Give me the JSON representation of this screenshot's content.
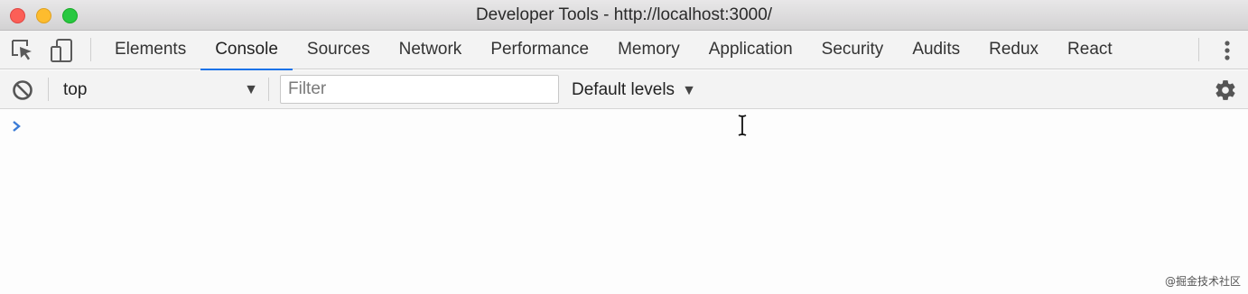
{
  "window": {
    "title": "Developer Tools - http://localhost:3000/"
  },
  "tabs": [
    {
      "label": "Elements",
      "active": false
    },
    {
      "label": "Console",
      "active": true
    },
    {
      "label": "Sources",
      "active": false
    },
    {
      "label": "Network",
      "active": false
    },
    {
      "label": "Performance",
      "active": false
    },
    {
      "label": "Memory",
      "active": false
    },
    {
      "label": "Application",
      "active": false
    },
    {
      "label": "Security",
      "active": false
    },
    {
      "label": "Audits",
      "active": false
    },
    {
      "label": "Redux",
      "active": false
    },
    {
      "label": "React",
      "active": false
    }
  ],
  "toolbar": {
    "context": "top",
    "filter_placeholder": "Filter",
    "filter_value": "",
    "levels": "Default levels"
  },
  "icons": {
    "inspect": "inspect-element-icon",
    "device": "device-toolbar-icon",
    "more": "more-vertical-icon",
    "clear": "clear-console-icon",
    "settings": "gear-icon",
    "prompt": "chevron-right-icon"
  },
  "colors": {
    "accent": "#1a73e8",
    "prompt": "#3b7bd6",
    "close": "#fc5f57",
    "minimize": "#fdbc2e",
    "maximize": "#28c840"
  },
  "watermark": "@掘金技术社区"
}
